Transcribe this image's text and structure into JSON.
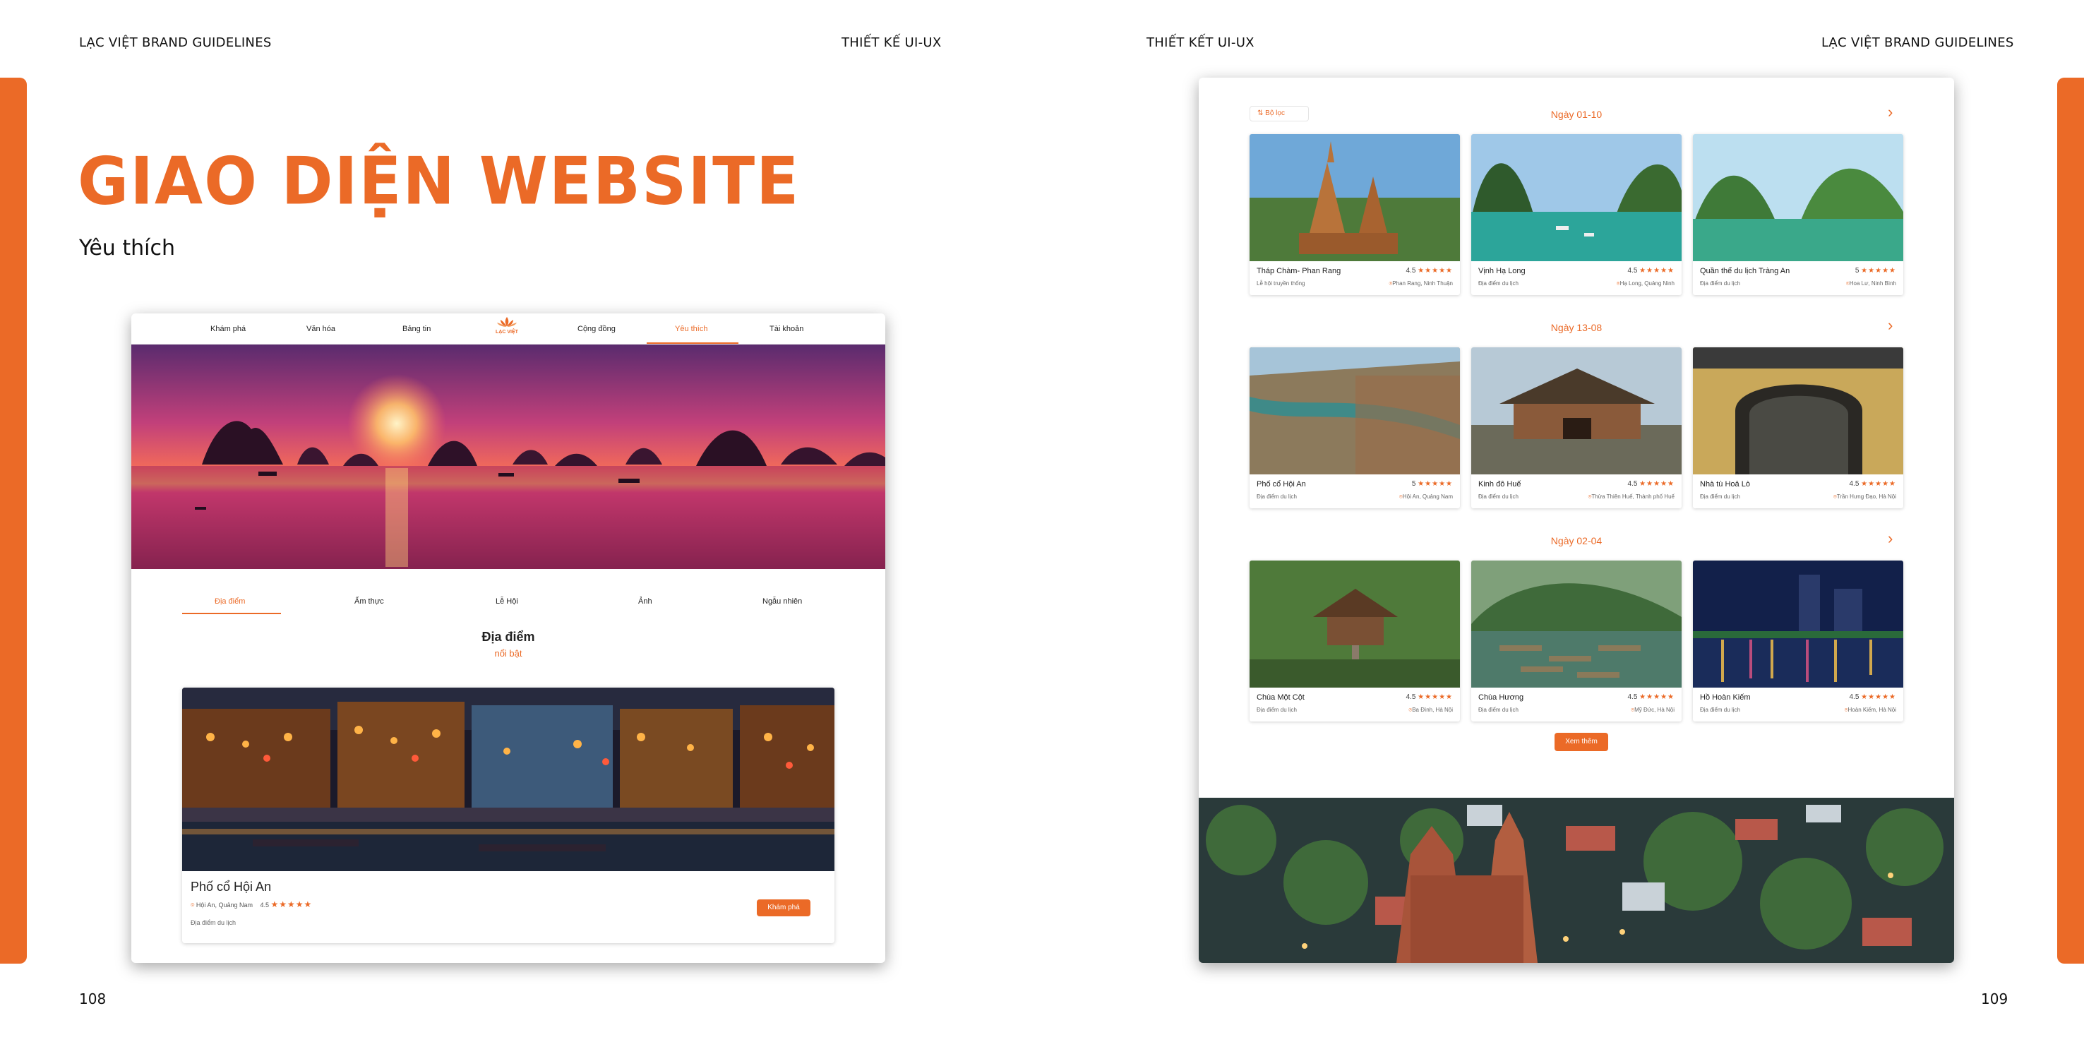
{
  "left_page": {
    "header_left": "LẠC VIỆT BRAND GUIDELINES",
    "header_right": "THIẾT KẾ UI-UX",
    "title": "GIAO DIỆN WEBSITE",
    "subtitle": "Yêu thích",
    "page_number": "108"
  },
  "right_page": {
    "header_left": "THIẾT KẾT UI-UX",
    "header_right": "LẠC VIỆT BRAND GUIDELINES",
    "page_number": "109"
  },
  "colors": {
    "accent": "#eb6a27"
  },
  "site": {
    "nav": [
      "Khám phá",
      "Văn hóa",
      "Bảng tin",
      "Cộng đồng",
      "Yêu thích",
      "Tài khoản"
    ],
    "nav_active": "Yêu thích",
    "logo_text": "LẠC VIỆT",
    "tabs": [
      "Địa điểm",
      "Ẩm thực",
      "Lễ Hội",
      "Ảnh",
      "Ngẫu nhiên"
    ],
    "section_title": "Địa điểm",
    "section_subtitle": "nổi bật",
    "featured": {
      "name": "Phố cổ Hội An",
      "location": "Hội An, Quảng Nam",
      "rating": "4.5",
      "stars": "★★★★★",
      "type": "Địa điểm du lịch",
      "button": "Khám phá"
    }
  },
  "favorites": {
    "filter_label": "Bộ lọc",
    "groups": [
      {
        "day": "Ngày 01-10",
        "cards": [
          {
            "name": "Tháp Chàm- Phan Rang",
            "rating": "4.5",
            "stars": "★★★★★",
            "type": "Lễ hội truyền thống",
            "location": "Phan Rang, Ninh Thuận"
          },
          {
            "name": "Vịnh Hạ Long",
            "rating": "4.5",
            "stars": "★★★★★",
            "type": "Địa điểm du lịch",
            "location": "Hạ Long, Quảng Ninh"
          },
          {
            "name": "Quần thể du lịch Tràng An",
            "rating": "5",
            "stars": "★★★★★",
            "type": "Địa điểm du lịch",
            "location": "Hoa Lư, Ninh Bình"
          }
        ]
      },
      {
        "day": "Ngày 13-08",
        "cards": [
          {
            "name": "Phố cổ Hội An",
            "rating": "5",
            "stars": "★★★★★",
            "type": "Địa điểm du lịch",
            "location": "Hội An, Quảng Nam"
          },
          {
            "name": "Kinh đô Huế",
            "rating": "4.5",
            "stars": "★★★★★",
            "type": "Địa điểm du lịch",
            "location": "Thừa Thiên Huế, Thành phố Huế"
          },
          {
            "name": "Nhà tù Hoả Lò",
            "rating": "4.5",
            "stars": "★★★★★",
            "type": "Địa điểm du lịch",
            "location": "Trần Hưng Đạo, Hà Nội"
          }
        ]
      },
      {
        "day": "Ngày 02-04",
        "cards": [
          {
            "name": "Chùa Một Cột",
            "rating": "4.5",
            "stars": "★★★★★",
            "type": "Địa điểm du lịch",
            "location": "Ba Đình, Hà Nội"
          },
          {
            "name": "Chùa Hương",
            "rating": "4.5",
            "stars": "★★★★★",
            "type": "Địa điểm du lịch",
            "location": "Mỹ Đức, Hà Nội"
          },
          {
            "name": "Hồ Hoàn Kiếm",
            "rating": "4.5",
            "stars": "★★★★★",
            "type": "Địa điểm du lịch",
            "location": "Hoàn Kiếm, Hà Nội"
          }
        ]
      }
    ],
    "more_button": "Xem thêm"
  }
}
